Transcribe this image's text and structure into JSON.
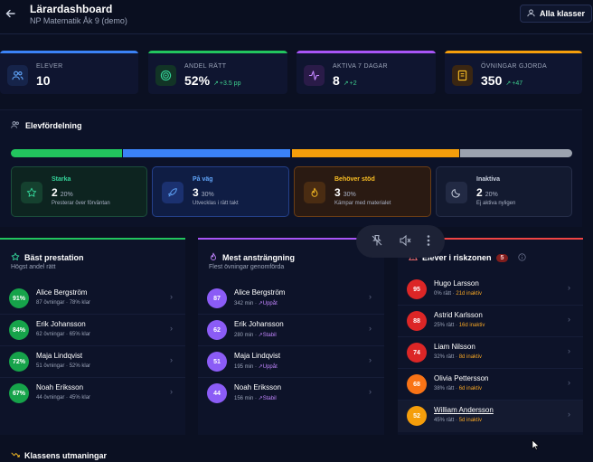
{
  "header": {
    "title": "Lärardashboard",
    "subtitle": "NP Matematik Åk 9 (demo)",
    "class_filter": "Alla klasser"
  },
  "stats": [
    {
      "label": "ELEVER",
      "value": "10",
      "delta": "",
      "color": "#3b82f6"
    },
    {
      "label": "ANDEL RÄTT",
      "value": "52%",
      "delta": "+3.5 pp",
      "color": "#22c55e"
    },
    {
      "label": "AKTIVA 7 DAGAR",
      "value": "8",
      "delta": "+2",
      "color": "#a855f7"
    },
    {
      "label": "ÖVNINGAR GJORDA",
      "value": "350",
      "delta": "+47",
      "color": "#f59e0b"
    }
  ],
  "distribution": {
    "title": "Elevfördelning",
    "segments": [
      {
        "name": "Starka",
        "fraction": 0.2,
        "color": "#22c55e"
      },
      {
        "name": "På väg",
        "fraction": 0.3,
        "color": "#3b82f6"
      },
      {
        "name": "Behöver stöd",
        "fraction": 0.3,
        "color": "#f59e0b"
      },
      {
        "name": "Inaktiva",
        "fraction": 0.2,
        "color": "#9ca3af"
      }
    ],
    "cards": [
      {
        "title": "Starka",
        "count": "2",
        "percent": "20%",
        "desc": "Presterar över förväntan"
      },
      {
        "title": "På väg",
        "count": "3",
        "percent": "30%",
        "desc": "Utvecklas i rätt takt"
      },
      {
        "title": "Behöver stöd",
        "count": "3",
        "percent": "30%",
        "desc": "Kämpar med materialet"
      },
      {
        "title": "Inaktiva",
        "count": "2",
        "percent": "20%",
        "desc": "Ej aktiva nyligen"
      }
    ]
  },
  "best": {
    "title": "Bäst prestation",
    "subtitle": "Högst andel rätt",
    "rows": [
      {
        "badge": "91%",
        "name": "Alice Bergström",
        "meta": "87 övningar · 78% klar"
      },
      {
        "badge": "84%",
        "name": "Erik Johansson",
        "meta": "62 övningar · 65% klar"
      },
      {
        "badge": "72%",
        "name": "Maja Lindqvist",
        "meta": "51 övningar · 52% klar"
      },
      {
        "badge": "67%",
        "name": "Noah Eriksson",
        "meta": "44 övningar · 45% klar"
      }
    ]
  },
  "effort": {
    "title": "Mest ansträngning",
    "subtitle": "Flest övningar genomförda",
    "rows": [
      {
        "badge": "87",
        "name": "Alice Bergström",
        "minutes": "342 min",
        "trend": "Uppåt"
      },
      {
        "badge": "62",
        "name": "Erik Johansson",
        "minutes": "280 min",
        "trend": "Stabil"
      },
      {
        "badge": "51",
        "name": "Maja Lindqvist",
        "minutes": "195 min",
        "trend": "Uppåt"
      },
      {
        "badge": "44",
        "name": "Noah Eriksson",
        "minutes": "156 min",
        "trend": "Stabil"
      }
    ]
  },
  "risk": {
    "title": "Elever i riskzonen",
    "count": "5",
    "rows": [
      {
        "badge": "95",
        "name": "Hugo Larsson",
        "correct": "0% rätt",
        "inactive": "21d inaktiv",
        "color": "#dc2626"
      },
      {
        "badge": "88",
        "name": "Astrid Karlsson",
        "correct": "25% rätt",
        "inactive": "16d inaktiv",
        "color": "#dc2626"
      },
      {
        "badge": "74",
        "name": "Liam Nilsson",
        "correct": "32% rätt",
        "inactive": "8d inaktiv",
        "color": "#dc2626"
      },
      {
        "badge": "68",
        "name": "Olivia Pettersson",
        "correct": "38% rätt",
        "inactive": "6d inaktiv",
        "color": "#f97316"
      },
      {
        "badge": "52",
        "name": "William Andersson",
        "correct": "45% rätt",
        "inactive": "5d inaktiv",
        "color": "#f59e0b"
      }
    ]
  },
  "challenges": {
    "title": "Klassens utmaningar"
  }
}
